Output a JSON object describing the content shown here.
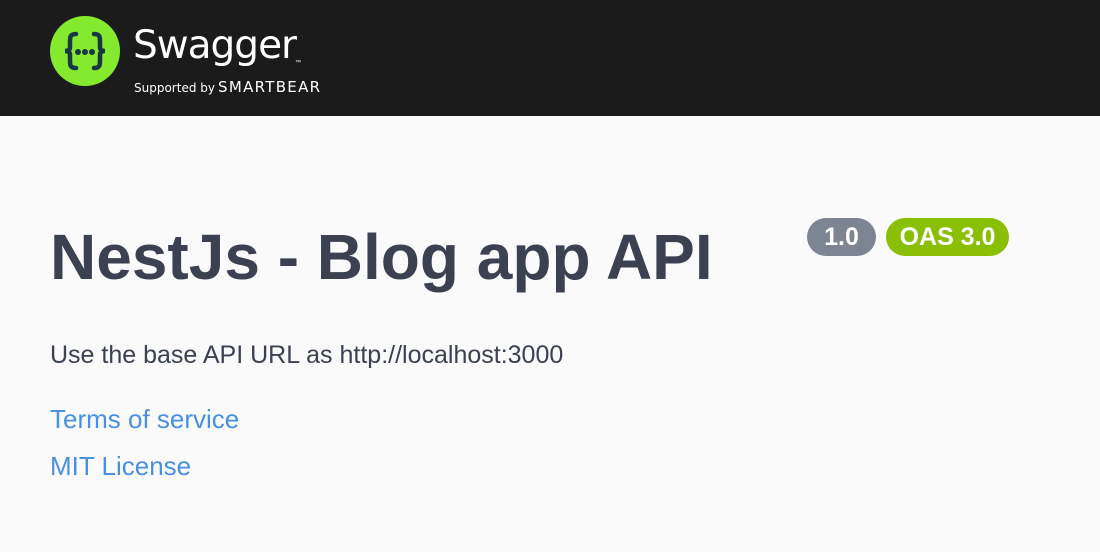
{
  "topbar": {
    "brand_name": "Swagger",
    "brand_tm": "™",
    "brand_supported": "Supported by",
    "brand_smartbear": "SMARTBEAR",
    "logo_glyph": "{···}",
    "logo_color": "#85ea2d",
    "background_color": "#1b1b1b"
  },
  "info": {
    "title": "NestJs - Blog app API",
    "version_badge": "1.0",
    "oas_badge": "OAS 3.0",
    "description": "Use the base API URL as http://localhost:3000",
    "links": {
      "terms": "Terms of service",
      "license": "MIT License"
    }
  },
  "colors": {
    "text": "#3b4151",
    "link": "#4990e2",
    "version_badge": "#7d8492",
    "oas_badge": "#89bf04"
  },
  "icons": {
    "logo": "swagger-braces-icon"
  }
}
